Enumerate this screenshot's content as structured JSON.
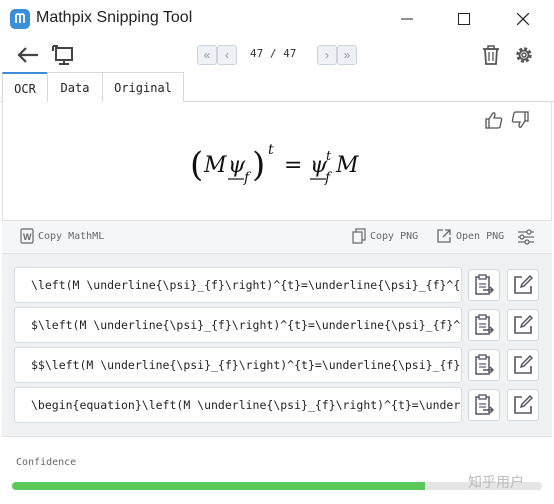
{
  "window": {
    "title": "Mathpix Snipping Tool"
  },
  "toolbar": {
    "back_icon": "arrow-left-icon",
    "snip_icon": "screen-snip-icon",
    "page_current": "47",
    "page_total": "47",
    "page_text": "47 / 47",
    "trash_icon": "trash-icon",
    "settings_icon": "gear-icon"
  },
  "tabs": [
    {
      "label": "OCR",
      "active": true
    },
    {
      "label": "Data",
      "active": false
    },
    {
      "label": "Original",
      "active": false
    }
  ],
  "actions": {
    "copy_mathml": "Copy MathML",
    "copy_png": "Copy PNG",
    "open_png": "Open PNG"
  },
  "results": [
    {
      "latex": "\\left(M \\underline{\\psi}_{f}\\right)^{t}=\\underline{\\psi}_{f}^{t} M"
    },
    {
      "latex": "$\\left(M \\underline{\\psi}_{f}\\right)^{t}=\\underline{\\psi}_{f}^{t} M$"
    },
    {
      "latex": "$$\\left(M \\underline{\\psi}_{f}\\right)^{t}=\\underline{\\psi}_{f}^{t} M$$"
    },
    {
      "latex": "\\begin{equation}\\left(M \\underline{\\psi}_{f}\\right)^{t}=\\underline{\\psi}_{f}^{t} M\\end{equation}"
    }
  ],
  "confidence": {
    "label": "Confidence",
    "value_fraction": 0.78,
    "color": "#5ac95a"
  },
  "watermark": "知乎用户",
  "colors": {
    "accent": "#3b8fd6",
    "icon": "#6a7480"
  }
}
